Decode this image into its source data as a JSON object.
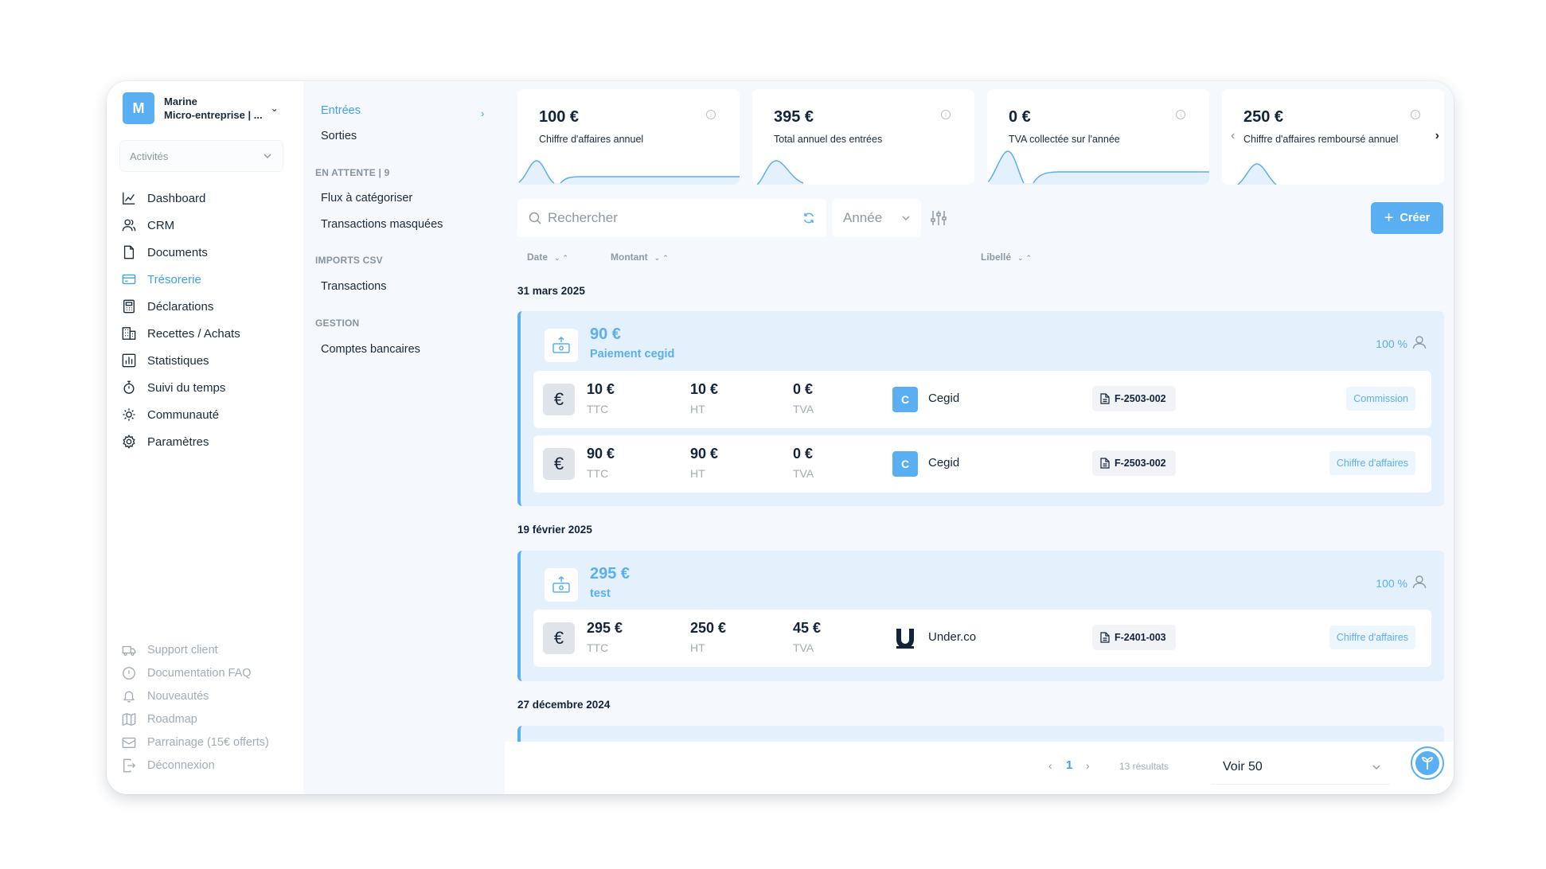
{
  "user": {
    "initial": "M",
    "name": "Marine",
    "org": "Micro-entreprise | ..."
  },
  "activities": "Activités",
  "nav": [
    {
      "label": "Dashboard",
      "icon": "chart-line-icon"
    },
    {
      "label": "CRM",
      "icon": "users-icon"
    },
    {
      "label": "Documents",
      "icon": "document-icon"
    },
    {
      "label": "Trésorerie",
      "icon": "credit-card-icon",
      "active": true
    },
    {
      "label": "Déclarations",
      "icon": "calculator-icon"
    },
    {
      "label": "Recettes / Achats",
      "icon": "building-icon"
    },
    {
      "label": "Statistiques",
      "icon": "bar-chart-icon"
    },
    {
      "label": "Suivi du temps",
      "icon": "stopwatch-icon"
    },
    {
      "label": "Communauté",
      "icon": "sun-icon"
    },
    {
      "label": "Paramètres",
      "icon": "gear-icon"
    }
  ],
  "footer_nav": [
    {
      "label": "Support client",
      "icon": "truck-icon"
    },
    {
      "label": "Documentation FAQ",
      "icon": "info-icon"
    },
    {
      "label": "Nouveautés",
      "icon": "bell-icon"
    },
    {
      "label": "Roadmap",
      "icon": "map-icon"
    },
    {
      "label": "Parrainage (15€ offerts)",
      "icon": "gift-icon"
    },
    {
      "label": "Déconnexion",
      "icon": "logout-icon"
    }
  ],
  "submenu": {
    "entrees": "Entrées",
    "sorties": "Sorties",
    "pending_head": "EN ATTENTE | 9",
    "flux": "Flux à catégoriser",
    "masquees": "Transactions masquées",
    "imports_head": "IMPORTS CSV",
    "transactions": "Transactions",
    "gestion_head": "GESTION",
    "comptes": "Comptes bancaires"
  },
  "stats": [
    {
      "value": "100 €",
      "label": "Chiffre d'affaires annuel"
    },
    {
      "value": "395 €",
      "label": "Total annuel des entrées"
    },
    {
      "value": "0 €",
      "label": "TVA collectée sur l'année"
    },
    {
      "value": "250 €",
      "label": "Chiffre d'affaires remboursé annuel"
    }
  ],
  "toolbar": {
    "search_placeholder": "Rechercher",
    "year": "Année",
    "create": "Créer"
  },
  "columns": {
    "date": "Date",
    "montant": "Montant",
    "libelle": "Libellé"
  },
  "groups": [
    {
      "date": "31 mars 2025",
      "amount": "90 €",
      "label": "Paiement cegid",
      "pct": "100 %",
      "rows": [
        {
          "ttc": "10 €",
          "ttc_l": "TTC",
          "ht": "10 €",
          "ht_l": "HT",
          "tva": "0 €",
          "tva_l": "TVA",
          "logo": "C",
          "client": "Cegid",
          "invoice": "F-2503-002",
          "tag": "Commission"
        },
        {
          "ttc": "90 €",
          "ttc_l": "TTC",
          "ht": "90 €",
          "ht_l": "HT",
          "tva": "0 €",
          "tva_l": "TVA",
          "logo": "C",
          "client": "Cegid",
          "invoice": "F-2503-002",
          "tag": "Chiffre d'affaires"
        }
      ]
    },
    {
      "date": "19 février 2025",
      "amount": "295 €",
      "label": "test",
      "pct": "100 %",
      "rows": [
        {
          "ttc": "295 €",
          "ttc_l": "TTC",
          "ht": "250 €",
          "ht_l": "HT",
          "tva": "45 €",
          "tva_l": "TVA",
          "logo": "",
          "client": "Under.co",
          "invoice": "F-2401-003",
          "tag": "Chiffre d'affaires"
        }
      ]
    },
    {
      "date": "27 décembre 2024"
    }
  ],
  "pager": {
    "page": "1",
    "results": "13 résultats",
    "per_page": "Voir 50"
  },
  "colors": {
    "accent": "#5aaef2",
    "active": "#3fa0ec",
    "panel": "#f5f9fd",
    "group": "#e4f1fc"
  }
}
